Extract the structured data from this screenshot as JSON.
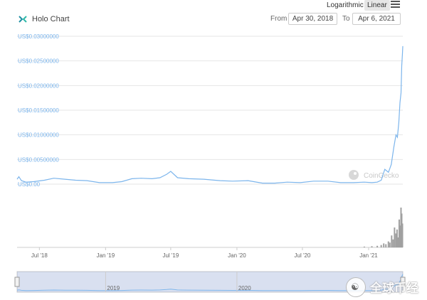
{
  "toolbar": {
    "log_label": "Logarithmic",
    "linear_label": "Linear",
    "from_label": "From",
    "from_value": "Apr 30, 2018",
    "to_label": "To",
    "to_value": "Apr 6, 2021"
  },
  "chart_title": "Holo Chart",
  "watermark_chart": "CoinGecko",
  "watermark_overlay": "全球币经",
  "colors": {
    "line": "#7cb5ec",
    "volume": "#a0a0a0",
    "navigator_fill": "rgba(102,133,194,0.25)",
    "axis_label": "#7cb5ec"
  },
  "chart_data": {
    "type": "line",
    "title": "Holo Chart",
    "xlabel": "",
    "ylabel": "",
    "ylim": [
      0,
      0.03
    ],
    "y_ticks": [
      0,
      0.005,
      0.01,
      0.015,
      0.02,
      0.025,
      0.03
    ],
    "y_tick_labels": [
      "US$0.00",
      "US$0.00500000",
      "US$0.01000000",
      "US$0.01500000",
      "US$0.02000000",
      "US$0.02500000",
      "US$0.03000000"
    ],
    "x_range": [
      "2018-04-30",
      "2021-04-06"
    ],
    "x_ticks": [
      "2018-07-01",
      "2019-01-01",
      "2019-07-01",
      "2020-01-01",
      "2020-07-01",
      "2021-01-01"
    ],
    "x_tick_labels": [
      "Jul '18",
      "Jan '19",
      "Jul '19",
      "Jan '20",
      "Jul '20",
      "Jan '21"
    ],
    "grid": true,
    "series": [
      {
        "name": "Price",
        "x": [
          "2018-04-30",
          "2018-05-05",
          "2018-05-12",
          "2018-05-25",
          "2018-06-15",
          "2018-07-15",
          "2018-08-10",
          "2018-09-10",
          "2018-10-10",
          "2018-11-10",
          "2018-12-15",
          "2019-01-20",
          "2019-02-15",
          "2019-03-15",
          "2019-04-10",
          "2019-05-10",
          "2019-06-01",
          "2019-06-20",
          "2019-07-01",
          "2019-07-20",
          "2019-08-20",
          "2019-10-01",
          "2019-11-15",
          "2019-12-20",
          "2020-02-01",
          "2020-03-12",
          "2020-04-15",
          "2020-05-20",
          "2020-06-25",
          "2020-08-01",
          "2020-09-10",
          "2020-10-15",
          "2020-11-20",
          "2020-12-20",
          "2021-01-10",
          "2021-01-25",
          "2021-02-05",
          "2021-02-15",
          "2021-02-25",
          "2021-03-05",
          "2021-03-12",
          "2021-03-18",
          "2021-03-22",
          "2021-03-26",
          "2021-03-29",
          "2021-04-01",
          "2021-04-03",
          "2021-04-05",
          "2021-04-06"
        ],
        "y": [
          0.001,
          0.0015,
          0.0007,
          0.0004,
          0.0005,
          0.0008,
          0.0012,
          0.001,
          0.0008,
          0.0007,
          0.0003,
          0.0003,
          0.0005,
          0.0011,
          0.0012,
          0.0011,
          0.0013,
          0.002,
          0.0026,
          0.0013,
          0.0011,
          0.001,
          0.0007,
          0.0006,
          0.0007,
          0.0002,
          0.0002,
          0.0004,
          0.0003,
          0.0006,
          0.0006,
          0.0003,
          0.0003,
          0.0004,
          0.0003,
          0.0004,
          0.0008,
          0.003,
          0.0024,
          0.004,
          0.0075,
          0.01,
          0.0095,
          0.0125,
          0.0165,
          0.0185,
          0.024,
          0.0265,
          0.028
        ]
      },
      {
        "name": "Volume",
        "x": [
          "2020-12-20",
          "2021-01-10",
          "2021-01-25",
          "2021-02-05",
          "2021-02-12",
          "2021-02-18",
          "2021-02-25",
          "2021-03-01",
          "2021-03-06",
          "2021-03-10",
          "2021-03-14",
          "2021-03-18",
          "2021-03-21",
          "2021-03-24",
          "2021-03-27",
          "2021-03-30",
          "2021-04-01",
          "2021-04-03",
          "2021-04-05"
        ],
        "y": [
          0.02,
          0.03,
          0.04,
          0.06,
          0.1,
          0.08,
          0.15,
          0.12,
          0.3,
          0.2,
          0.5,
          0.35,
          0.45,
          0.25,
          0.7,
          0.55,
          1.0,
          0.85,
          0.6
        ]
      }
    ],
    "navigator_ticks": [
      "2019-01-01",
      "2020-01-01"
    ],
    "navigator_tick_labels": [
      "2019",
      "2020"
    ]
  }
}
